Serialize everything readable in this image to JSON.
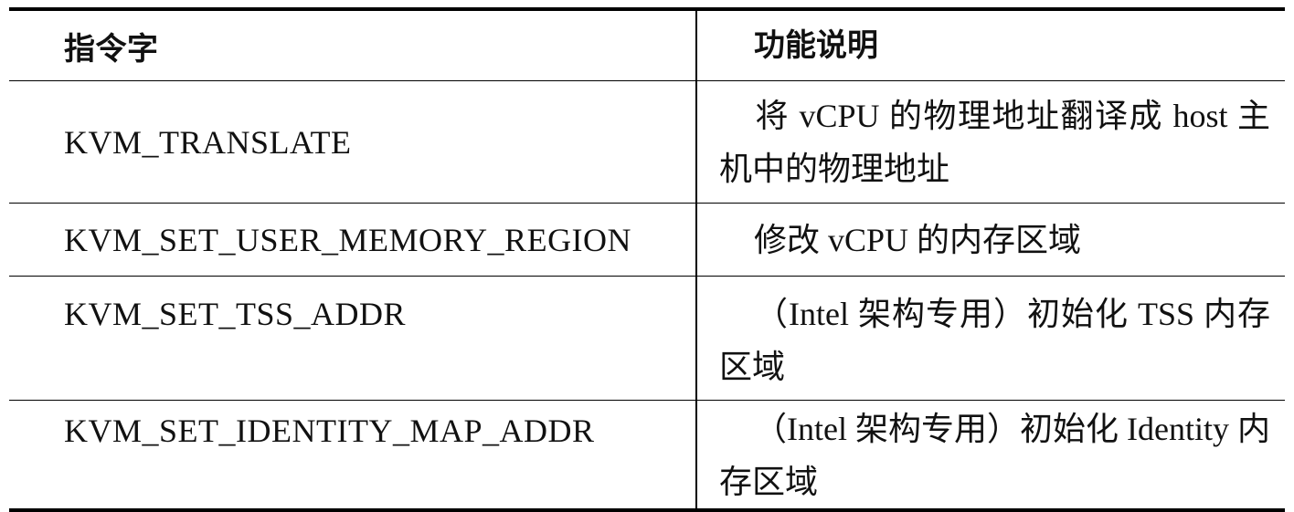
{
  "table": {
    "headers": [
      "指令字",
      "功能说明"
    ],
    "rows": [
      {
        "command": "KVM_TRANSLATE",
        "description": "将 vCPU 的物理地址翻译成 host 主机中的物理地址"
      },
      {
        "command": "KVM_SET_USER_MEMORY_REGION",
        "description": "修改 vCPU 的内存区域"
      },
      {
        "command": "KVM_SET_TSS_ADDR",
        "description": "（Intel 架构专用）初始化 TSS 内存区域"
      },
      {
        "command": "KVM_SET_IDENTITY_MAP_ADDR",
        "description": "（Intel 架构专用）初始化 Identity 内存区域"
      }
    ]
  }
}
